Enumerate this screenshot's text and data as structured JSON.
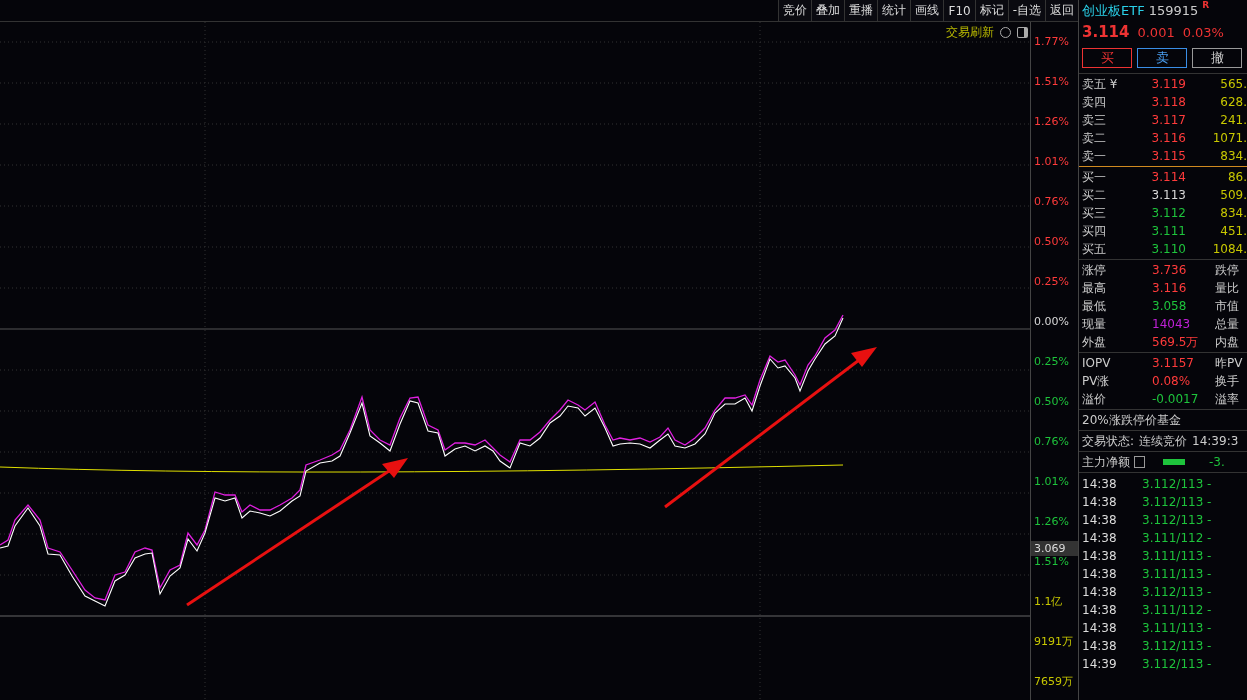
{
  "toolbar": [
    "竞价",
    "叠加",
    "重播",
    "统计",
    "画线",
    "F10",
    "标记",
    "-自选",
    "返回"
  ],
  "chart_header": {
    "refresh": "交易刷新"
  },
  "axis": [
    {
      "label": "1.77%",
      "kind": "up"
    },
    {
      "label": "1.51%",
      "kind": "up"
    },
    {
      "label": "1.26%",
      "kind": "up"
    },
    {
      "label": "1.01%",
      "kind": "up"
    },
    {
      "label": "0.76%",
      "kind": "up"
    },
    {
      "label": "0.50%",
      "kind": "up"
    },
    {
      "label": "0.25%",
      "kind": "up"
    },
    {
      "label": "0.00%",
      "kind": "flat"
    },
    {
      "label": "0.25%",
      "kind": "down"
    },
    {
      "label": "0.50%",
      "kind": "down"
    },
    {
      "label": "0.76%",
      "kind": "down"
    },
    {
      "label": "1.01%",
      "kind": "down"
    },
    {
      "label": "1.26%",
      "kind": "down"
    },
    {
      "label": "1.51%",
      "kind": "down"
    },
    {
      "label": "1.1亿",
      "kind": "volume"
    },
    {
      "label": "9191万",
      "kind": "volume"
    },
    {
      "label": "7659万",
      "kind": "volume"
    }
  ],
  "price_marker": "3.069",
  "quote": {
    "name": "创业板ETF",
    "code": "159915",
    "badge": "R",
    "price": "3.114",
    "change": "0.001",
    "percent": "0.03%"
  },
  "buttons": [
    {
      "label": "买",
      "kind": "buy"
    },
    {
      "label": "卖",
      "kind": "sell"
    },
    {
      "label": "撤",
      "kind": "cancel"
    }
  ],
  "asks": [
    {
      "label": "卖五 ¥",
      "price": "3.119",
      "volume": "565.",
      "kind": "up"
    },
    {
      "label": "卖四",
      "price": "3.118",
      "volume": "628.",
      "kind": "up"
    },
    {
      "label": "卖三",
      "price": "3.117",
      "volume": "241.",
      "kind": "up"
    },
    {
      "label": "卖二",
      "price": "3.116",
      "volume": "1071.",
      "kind": "up"
    },
    {
      "label": "卖一",
      "price": "3.115",
      "volume": "834.",
      "kind": "up"
    }
  ],
  "bids": [
    {
      "label": "买一",
      "price": "3.114",
      "volume": "86.",
      "kind": "up"
    },
    {
      "label": "买二",
      "price": "3.113",
      "volume": "509.",
      "kind": "flat"
    },
    {
      "label": "买三",
      "price": "3.112",
      "volume": "834.",
      "kind": "down"
    },
    {
      "label": "买四",
      "price": "3.111",
      "volume": "451.",
      "kind": "down"
    },
    {
      "label": "买五",
      "price": "3.110",
      "volume": "1084.",
      "kind": "down"
    }
  ],
  "stats": [
    {
      "label": "涨停",
      "value": "3.736",
      "kind": "up",
      "label2": "跌停"
    },
    {
      "label": "最高",
      "value": "3.116",
      "kind": "up",
      "label2": "量比"
    },
    {
      "label": "最低",
      "value": "3.058",
      "kind": "down",
      "label2": "市值"
    },
    {
      "label": "现量",
      "value": "14043",
      "kind": "volume",
      "label2": "总量"
    },
    {
      "label": "外盘",
      "value": "569.5万",
      "kind": "up",
      "label2": "内盘"
    }
  ],
  "fund_stats": [
    {
      "label": "IOPV",
      "value": "3.1157",
      "kind": "up",
      "label2": "昨PV"
    },
    {
      "label": "PV涨",
      "value": "0.08%",
      "kind": "up",
      "label2": "换手"
    },
    {
      "label": "溢价",
      "value": "-0.0017",
      "kind": "down",
      "label2": "溢率"
    }
  ],
  "fund_type": "20%涨跌停价基金",
  "trade_status": {
    "label": "交易状态:",
    "value": "连续竞价",
    "time": "14:39:3"
  },
  "net_flow": {
    "label": "主力净额",
    "value": "-3."
  },
  "trades": [
    {
      "time": "14:38",
      "price": "3.112/113 -"
    },
    {
      "time": "14:38",
      "price": "3.112/113 -"
    },
    {
      "time": "14:38",
      "price": "3.112/113 -"
    },
    {
      "time": "14:38",
      "price": "3.111/112 -"
    },
    {
      "time": "14:38",
      "price": "3.111/113 -"
    },
    {
      "time": "14:38",
      "price": "3.111/113 -"
    },
    {
      "time": "14:38",
      "price": "3.112/113 -"
    },
    {
      "time": "14:38",
      "price": "3.111/112 -"
    },
    {
      "time": "14:38",
      "price": "3.111/113 -"
    },
    {
      "time": "14:38",
      "price": "3.112/113 -"
    },
    {
      "time": "14:39",
      "price": "3.112/113 -"
    }
  ]
}
